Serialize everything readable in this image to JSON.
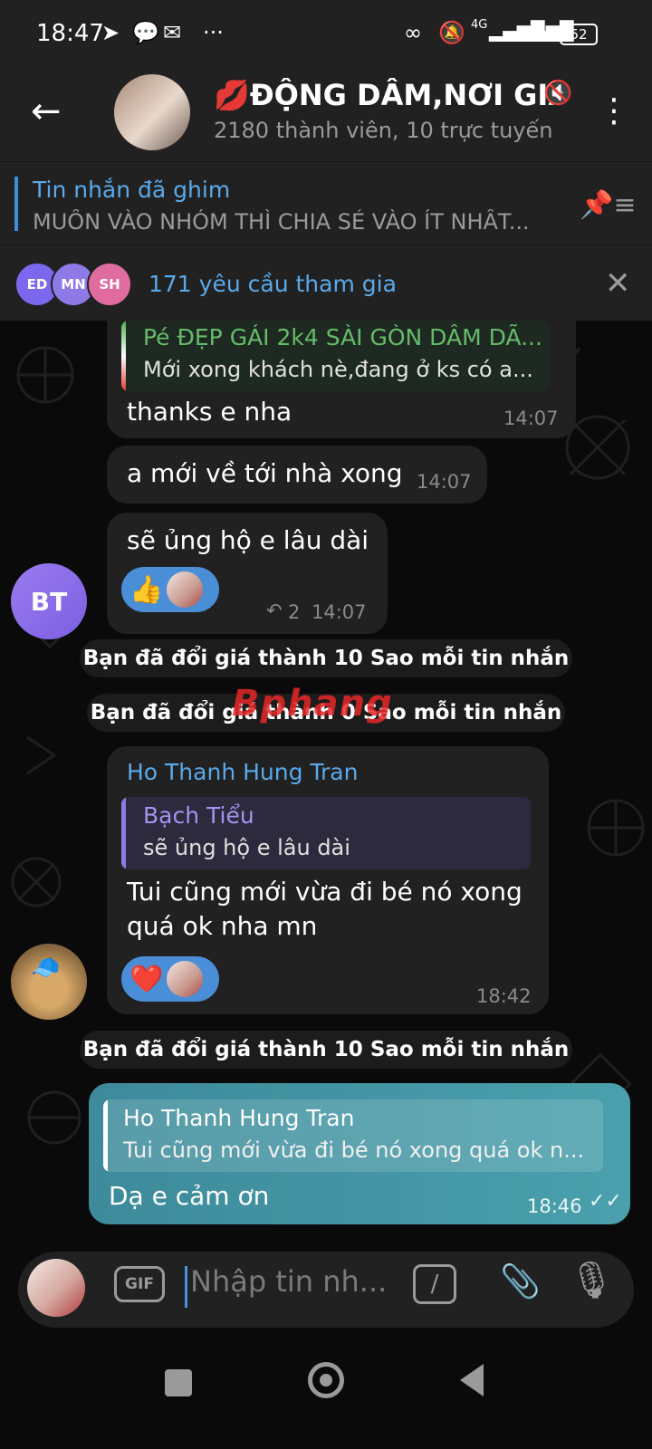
{
  "status": {
    "time": "18:47",
    "battery": "52",
    "network": "4G",
    "icons": [
      "telegram-icon",
      "chat-icon",
      "mail-icon",
      "more-dots-icon",
      "link-icon",
      "bell-off-icon",
      "signal-icon",
      "signal-icon",
      "battery-icon"
    ]
  },
  "header": {
    "title": "💋ĐỘNG DÂM,NƠI GIA",
    "subtitle": "2180 thành viên, 10 trực tuyến"
  },
  "pinned": {
    "title": "Tin nhắn đã ghim",
    "text": "MUỐN VÀO NHÓM THÌ CHIA SẺ VÀO ÍT NHẤT..."
  },
  "join": {
    "avatars": [
      {
        "initials": "ED",
        "color": "#7b68ee"
      },
      {
        "initials": "MN",
        "color": "#8e7ae6"
      },
      {
        "initials": "SH",
        "color": "#e06c9f"
      }
    ],
    "text": "171 yêu cầu tham gia"
  },
  "messages": {
    "m1": {
      "reply_name": "Pé ĐẸP GÁI 2k4 SÀI GÒN DÂM DÃ...",
      "reply_text": "Mới xong khách nè,đang ở ks có a...",
      "text": "thanks e nha",
      "time": "14:07"
    },
    "m2": {
      "text": "a mới về tới nhà xong",
      "time": "14:07"
    },
    "m3": {
      "text": "sẽ ủng hộ e lâu dài",
      "reaction": "👍",
      "replies": "2",
      "time": "14:07",
      "avatar": "BT"
    },
    "svc1": "Bạn đã đổi giá thành 10 Sao mỗi tin nhắn",
    "svc2": "Bạn đã đổi giá thành 0 Sao mỗi tin nhắn",
    "watermark": "Bphang",
    "m4": {
      "sender": "Ho Thanh Hung Tran",
      "reply_name": "Bạch Tiểu",
      "reply_text": "sẽ ủng hộ e lâu dài",
      "text_line1": "Tui cũng mới vừa đi bé nó xong",
      "text_line2": "quá ok nha mn",
      "reaction": "❤️",
      "time": "18:42"
    },
    "svc3": "Bạn đã đổi giá thành 10 Sao mỗi tin nhắn",
    "m5": {
      "reply_name": "Ho Thanh Hung Tran",
      "reply_text": "Tui cũng mới vừa đi bé nó xong quá ok n...",
      "text": "Dạ e cảm ơn",
      "time": "18:46"
    }
  },
  "input": {
    "placeholder": "Nhập tin nh...",
    "gif_label": "GIF",
    "slash": "/"
  },
  "colors": {
    "accent": "#5aa9ea",
    "own_bubble": "#4a9aa8",
    "reaction": "#4a8ed8",
    "header_bg": "#212121"
  }
}
